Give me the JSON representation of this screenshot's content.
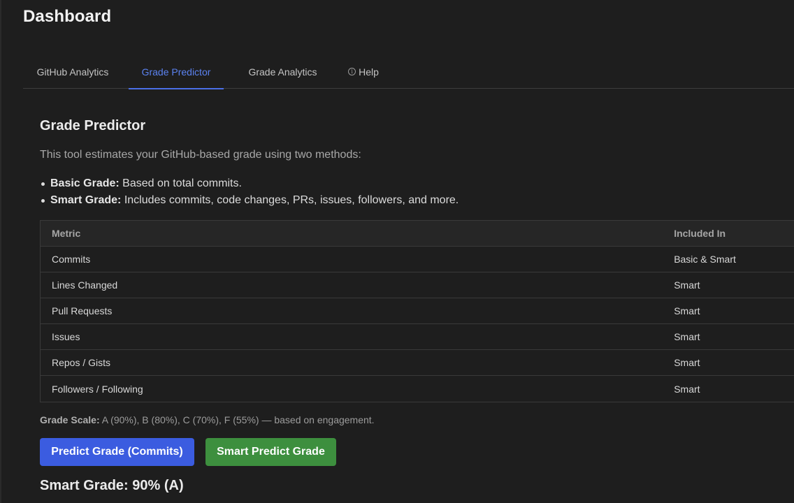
{
  "page": {
    "title": "Dashboard"
  },
  "tabs": [
    {
      "label": "GitHub Analytics",
      "active": false
    },
    {
      "label": "Grade Predictor",
      "active": true
    },
    {
      "label": "Grade Analytics",
      "active": false
    },
    {
      "label": "Help",
      "icon": "info-circle-icon",
      "active": false
    }
  ],
  "section": {
    "title": "Grade Predictor",
    "intro": "This tool estimates your GitHub-based grade using two methods:",
    "bullets": [
      {
        "term": "Basic Grade:",
        "text": " Based on total commits."
      },
      {
        "term": "Smart Grade:",
        "text": " Includes commits, code changes, PRs, issues, followers, and more."
      }
    ]
  },
  "table": {
    "headers": {
      "metric": "Metric",
      "included": "Included In"
    },
    "rows": [
      {
        "metric": "Commits",
        "included": "Basic & Smart"
      },
      {
        "metric": "Lines Changed",
        "included": "Smart"
      },
      {
        "metric": "Pull Requests",
        "included": "Smart"
      },
      {
        "metric": "Issues",
        "included": "Smart"
      },
      {
        "metric": "Repos / Gists",
        "included": "Smart"
      },
      {
        "metric": "Followers / Following",
        "included": "Smart"
      }
    ]
  },
  "grade_scale": {
    "label": "Grade Scale:",
    "text": " A (90%), B (80%), C (70%), F (55%) — based on engagement."
  },
  "buttons": {
    "basic": "Predict Grade (Commits)",
    "smart": "Smart Predict Grade"
  },
  "result": {
    "text": "Smart Grade: 90% (A)"
  },
  "colors": {
    "accent": "#4a6fe6",
    "basic_button": "#3b5ce0",
    "smart_button": "#3d8f3e",
    "background": "#1e1e1e"
  }
}
